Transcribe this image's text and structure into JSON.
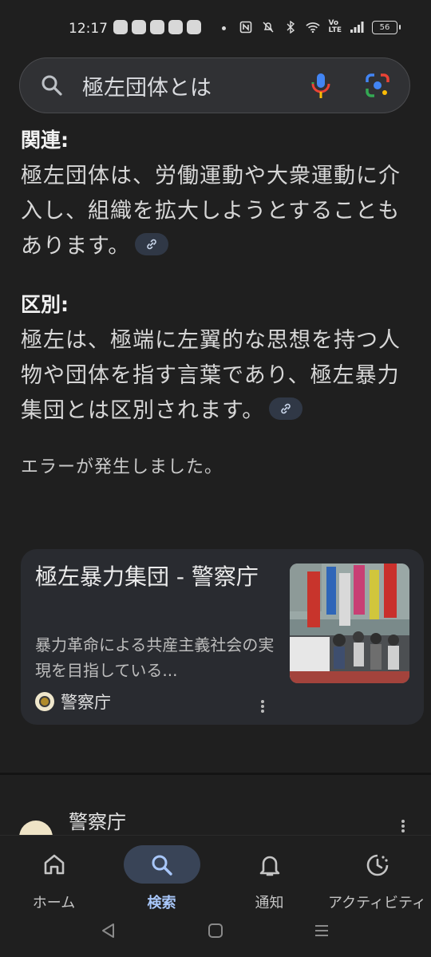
{
  "status_bar": {
    "time": "12:17",
    "battery": "56",
    "volte_top": "Vo",
    "volte_bottom": "LTE",
    "icons": [
      "nfc-icon",
      "mute-icon",
      "bluetooth-icon",
      "wifi-icon",
      "volte-icon",
      "signal-icon",
      "battery-icon"
    ]
  },
  "search": {
    "query": "極左団体とは",
    "icons": [
      "search-icon",
      "mic-icon",
      "lens-icon"
    ]
  },
  "sections": [
    {
      "heading": "関連:",
      "text": "極左団体は、労働運動や大衆運動に介入し、組織を拡大しようとすることもあります。"
    },
    {
      "heading": "区別:",
      "text": "極左は、極端に左翼的な思想を持つ人物や団体を指す言葉であり、極左暴力集団とは区別されます。"
    }
  ],
  "error_message": "エラーが発生しました。",
  "result_card": {
    "title": "極左暴力集団 - 警察庁",
    "snippet": "暴力革命による共産主義社会の実現を目指している...",
    "source": "警察庁"
  },
  "next_result": {
    "source": "警察庁"
  },
  "bottom_nav": {
    "items": [
      {
        "label": "ホーム",
        "icon": "home-icon",
        "active": false
      },
      {
        "label": "検索",
        "icon": "search-icon",
        "active": true
      },
      {
        "label": "通知",
        "icon": "bell-icon",
        "active": false
      },
      {
        "label": "アクティビティ",
        "icon": "activity-icon",
        "active": false
      }
    ]
  },
  "colors": {
    "background": "#1f1f1f",
    "accent": "#a8c7fa",
    "active_pill": "#394457",
    "card": "#292b30"
  }
}
